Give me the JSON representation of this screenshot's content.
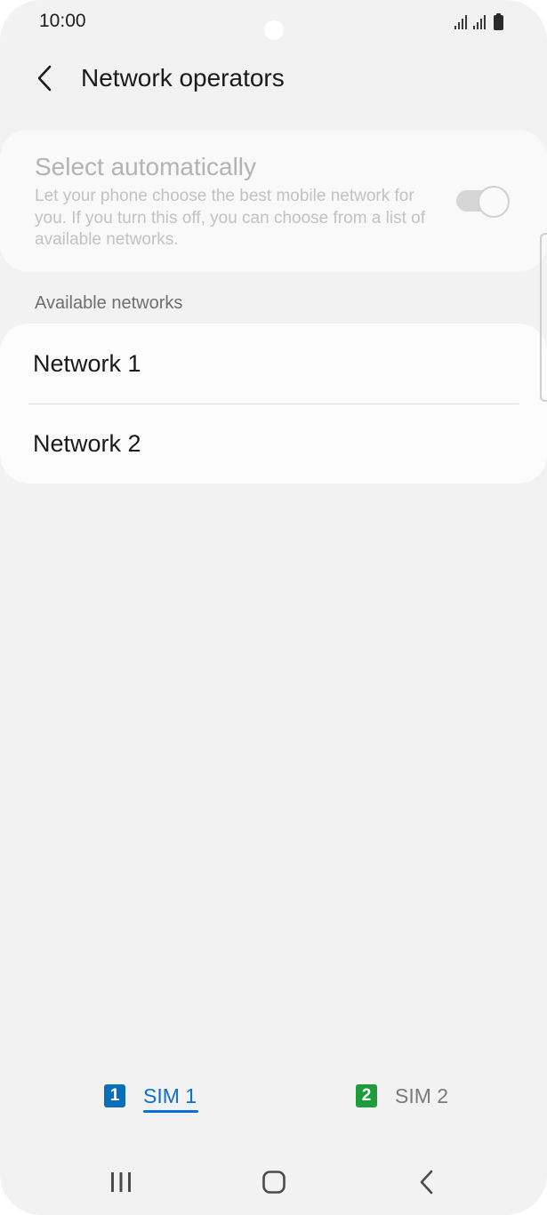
{
  "status_bar": {
    "time": "10:00",
    "icons": [
      "signal-icon",
      "signal-icon",
      "battery-icon"
    ]
  },
  "header": {
    "back_icon": "chevron-left-icon",
    "title": "Network operators"
  },
  "auto_select": {
    "title": "Select automatically",
    "description": "Let your phone choose the best mobile network for you. If you turn this off, you can choose from a list of available networks.",
    "toggle_on": true,
    "enabled": false
  },
  "available_networks": {
    "heading": "Available networks",
    "items": [
      {
        "label": "Network 1"
      },
      {
        "label": "Network 2"
      }
    ]
  },
  "sim_tabs": [
    {
      "badge": "1",
      "label": "SIM 1",
      "selected": true,
      "badge_color": "#0a6fb8",
      "label_color": "#0c6fd6"
    },
    {
      "badge": "2",
      "label": "SIM 2",
      "selected": false,
      "badge_color": "#1e9b3a",
      "label_color": "#7a7a7a"
    }
  ],
  "nav_bar": {
    "recents_icon": "recent-apps-icon",
    "home_icon": "home-icon",
    "back_icon": "back-icon"
  }
}
